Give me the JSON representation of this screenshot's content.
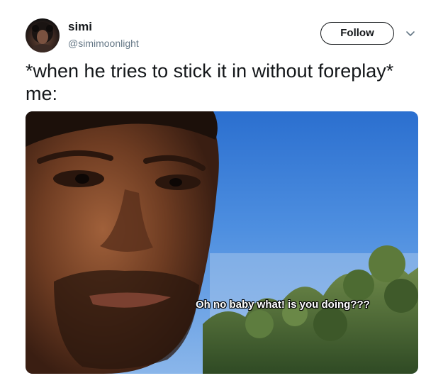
{
  "tweet": {
    "author": {
      "display_name": "simi",
      "handle": "@simimoonlight"
    },
    "follow_label": "Follow",
    "text": "*when he tries to stick it in without foreplay*\nme:",
    "media": {
      "caption": "Oh no baby what! is you doing???"
    }
  },
  "colors": {
    "text": "#14171a",
    "secondary": "#657786",
    "sky": "#4e8fe0"
  },
  "icons": {
    "more": "chevron-down-icon"
  }
}
